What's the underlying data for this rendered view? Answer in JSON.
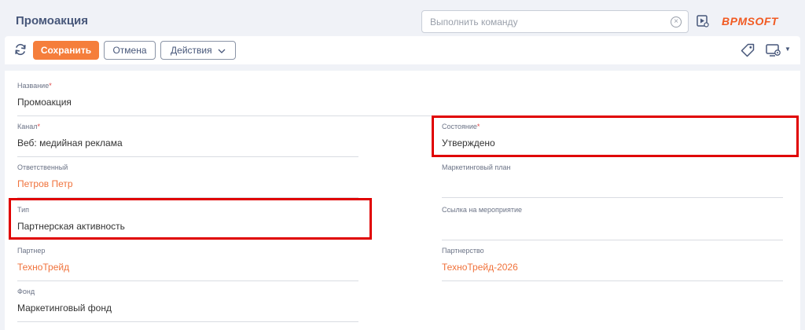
{
  "header": {
    "title": "Промоакция",
    "command_placeholder": "Выполнить команду",
    "command_value": "",
    "clear_icon": "×",
    "logo": "BPMSOFT"
  },
  "toolbar": {
    "save_label": "Сохранить",
    "cancel_label": "Отмена",
    "actions_label": "Действия",
    "actions_chevron": "⌵"
  },
  "colors": {
    "accent": "#f57e3b",
    "link": "#f0723b",
    "title": "#47577a",
    "highlight": "#e00000"
  },
  "form": {
    "name": {
      "label": "Название",
      "required": "*",
      "value": "Промоакция"
    },
    "channel": {
      "label": "Канал",
      "required": "*",
      "value": "Веб: медийная реклама"
    },
    "state": {
      "label": "Состояние",
      "required": "*",
      "value": "Утверждено"
    },
    "owner": {
      "label": "Ответственный",
      "value": "Петров Петр"
    },
    "marketing_plan": {
      "label": "Маркетинговый план",
      "value": ""
    },
    "type": {
      "label": "Тип",
      "value": "Партнерская активность"
    },
    "event_link": {
      "label": "Ссылка на мероприятие",
      "value": ""
    },
    "partner": {
      "label": "Партнер",
      "value": "ТехноТрейд"
    },
    "partnership": {
      "label": "Партнерство",
      "value": "ТехноТрейд-2026"
    },
    "fund": {
      "label": "Фонд",
      "value": "Маркетинговый фонд"
    }
  },
  "icons": {
    "refresh": "refresh-icon",
    "video": "video-play-icon",
    "tag": "tag-icon",
    "layout": "layout-settings-icon",
    "clear": "clear-circle-icon"
  }
}
